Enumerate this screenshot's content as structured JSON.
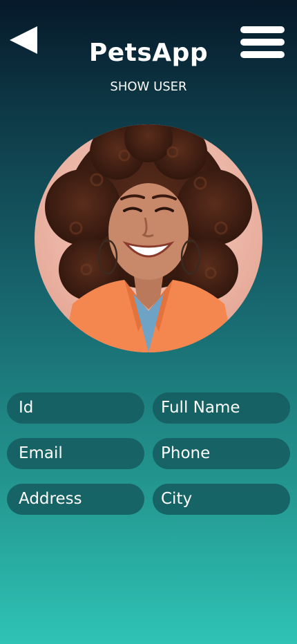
{
  "header": {
    "app_title": "PetsApp",
    "page_subtitle": "SHOW USER",
    "back_icon": "back-triangle-icon",
    "menu_icon": "hamburger-menu-icon"
  },
  "profile": {
    "avatar_description": "user-photo"
  },
  "fields": {
    "id": "Id",
    "full_name": "Full Name",
    "email": "Email",
    "phone": "Phone",
    "address": "Address",
    "city": "City"
  },
  "colors": {
    "gradient_top": "#06192a",
    "gradient_bottom": "#2fc3b5",
    "field_bg": "#165c60",
    "text": "#ffffff"
  }
}
